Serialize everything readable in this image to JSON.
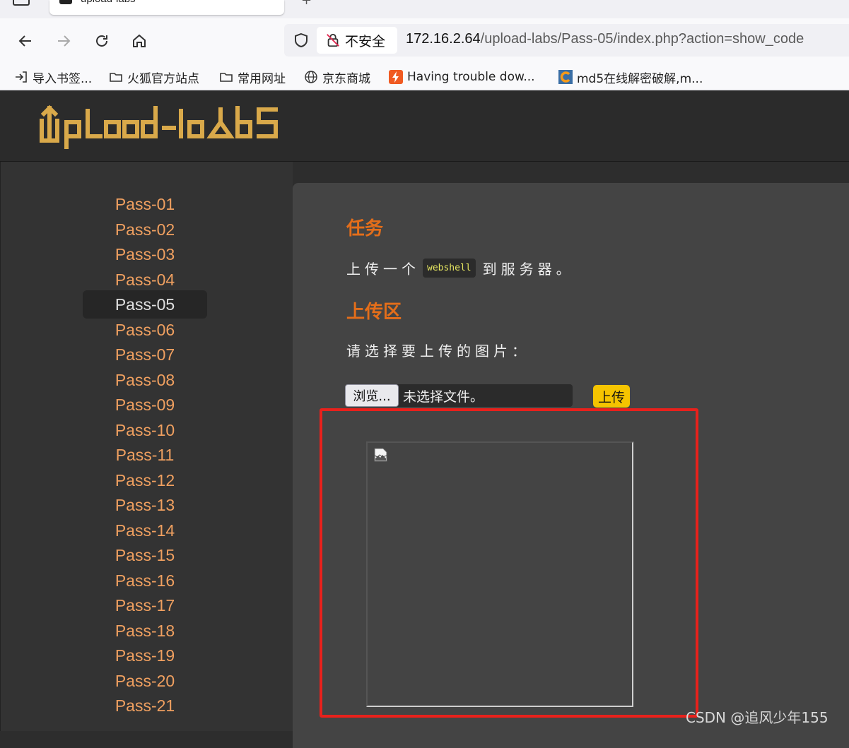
{
  "browser": {
    "tab_title": "upload-labs",
    "new_tab": "+",
    "security_label": "不安全",
    "url_host": "172.16.2.64",
    "url_rest": "/upload-labs/Pass-05/index.php?action=show_code"
  },
  "bookmarks": [
    {
      "label": "导入书签...",
      "icon": "import-icon"
    },
    {
      "label": "火狐官方站点",
      "icon": "folder-icon"
    },
    {
      "label": "常用网址",
      "icon": "folder-icon"
    },
    {
      "label": "京东商城",
      "icon": "globe-icon"
    },
    {
      "label": "Having trouble dow...",
      "icon": "bolt-icon"
    },
    {
      "label": "md5在线解密破解,m...",
      "icon": "c-logo-icon"
    }
  ],
  "sidebar": {
    "items": [
      "Pass-01",
      "Pass-02",
      "Pass-03",
      "Pass-04",
      "Pass-05",
      "Pass-06",
      "Pass-07",
      "Pass-08",
      "Pass-09",
      "Pass-10",
      "Pass-11",
      "Pass-12",
      "Pass-13",
      "Pass-14",
      "Pass-15",
      "Pass-16",
      "Pass-17",
      "Pass-18",
      "Pass-19",
      "Pass-20",
      "Pass-21"
    ],
    "active": "Pass-05"
  },
  "main": {
    "task_heading": "任务",
    "task_before": "上传一个",
    "task_code": "webshell",
    "task_after": "到服务器。",
    "upload_heading": "上传区",
    "choose_label": "请选择要上传的图片：",
    "browse_label": "浏览...",
    "no_file_label": "未选择文件。",
    "upload_button": "上传"
  },
  "watermark": "CSDN @追风少年155",
  "colors": {
    "accent": "#e46e1a",
    "nav_link": "#f0a060",
    "upload_btn": "#f5c400",
    "highlight": "#e8211c"
  }
}
